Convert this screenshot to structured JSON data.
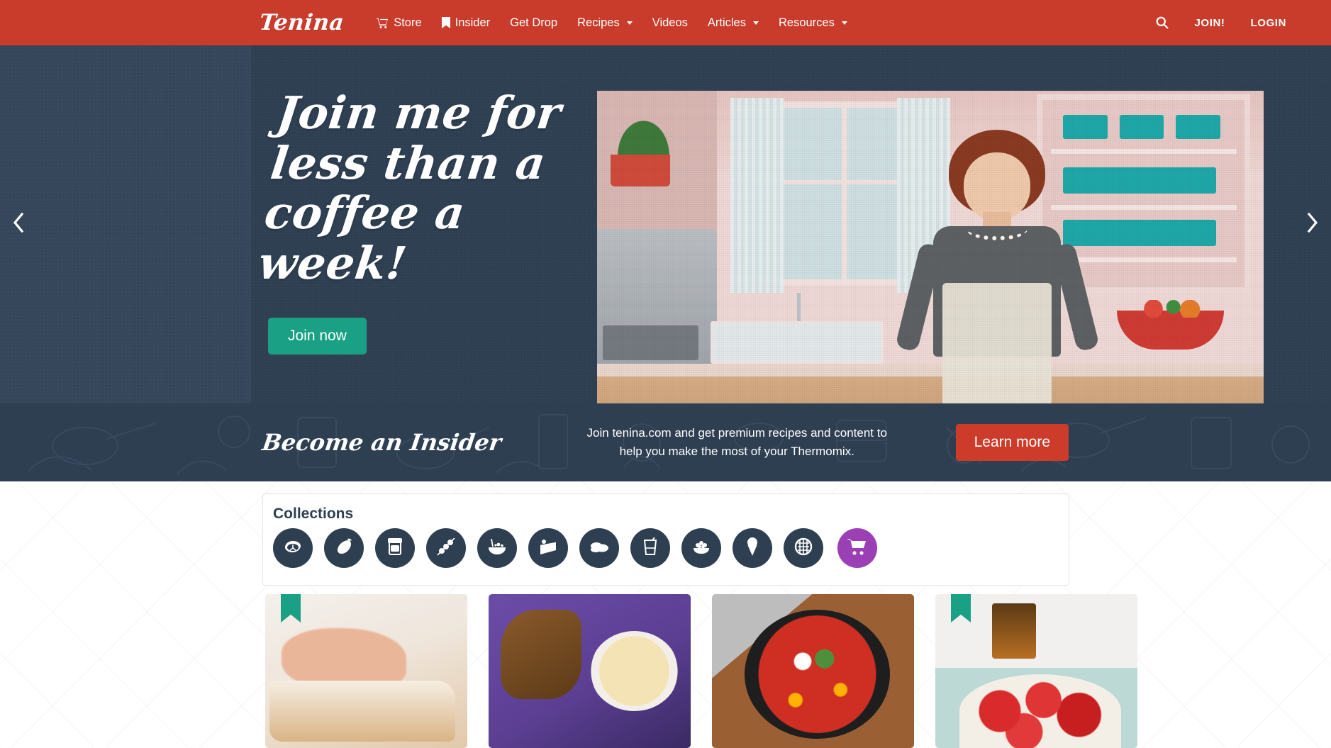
{
  "nav": {
    "brand": "Tenina",
    "links": [
      {
        "label": "Store",
        "icon": "cart-icon",
        "has_caret": false
      },
      {
        "label": "Insider",
        "icon": "bookmark-icon",
        "has_caret": false
      },
      {
        "label": "Get Drop",
        "icon": null,
        "has_caret": false
      },
      {
        "label": "Recipes",
        "icon": null,
        "has_caret": true
      },
      {
        "label": "Videos",
        "icon": null,
        "has_caret": false
      },
      {
        "label": "Articles",
        "icon": null,
        "has_caret": true
      },
      {
        "label": "Resources",
        "icon": null,
        "has_caret": true
      }
    ],
    "search_icon": "search-icon",
    "join_label": "JOIN!",
    "login_label": "LOGIN",
    "background_color": "#c93c2c"
  },
  "hero": {
    "title": "Join me for less than a coffee a week!",
    "cta_label": "Join now",
    "cta_color": "#1aa085",
    "background_color": "#2e3f52",
    "prev_icon": "chevron-left-icon",
    "next_icon": "chevron-right-icon"
  },
  "insider": {
    "title": "Become an Insider",
    "description": "Join tenina.com and get premium recipes and content to help you make the most of your Thermomix.",
    "cta_label": "Learn more",
    "cta_color": "#cd3b2b",
    "background_color": "#2e3f52"
  },
  "collections": {
    "title": "Collections",
    "icon_color": "#2e3f52",
    "cart_color": "#9b3fb5",
    "items": [
      {
        "name": "meat-icon",
        "label": "Meat"
      },
      {
        "name": "eggplant-icon",
        "label": "Vegetables"
      },
      {
        "name": "jar-icon",
        "label": "Preserves"
      },
      {
        "name": "skewer-icon",
        "label": "Skewers"
      },
      {
        "name": "salad-bowl-icon",
        "label": "Salads"
      },
      {
        "name": "cake-slice-icon",
        "label": "Cakes"
      },
      {
        "name": "bread-icon",
        "label": "Breads"
      },
      {
        "name": "drink-glass-icon",
        "label": "Drinks"
      },
      {
        "name": "bowl-icon",
        "label": "Snacks"
      },
      {
        "name": "ice-cream-icon",
        "label": "Ice Cream"
      },
      {
        "name": "waffle-icon",
        "label": "Waffles"
      },
      {
        "name": "shopping-cart-icon",
        "label": "Store"
      }
    ]
  },
  "cards": [
    {
      "name": "card-dough",
      "alt": "Hands folding dough",
      "bookmarked": true
    },
    {
      "name": "card-soup",
      "alt": "Two bowls of creamy soup with grilled bread",
      "bookmarked": false
    },
    {
      "name": "card-shakshuka",
      "alt": "Skillet of shakshuka with eggs and bread",
      "bookmarked": false
    },
    {
      "name": "card-strawberries",
      "alt": "Pancakes with strawberries and cream",
      "bookmarked": true
    }
  ]
}
